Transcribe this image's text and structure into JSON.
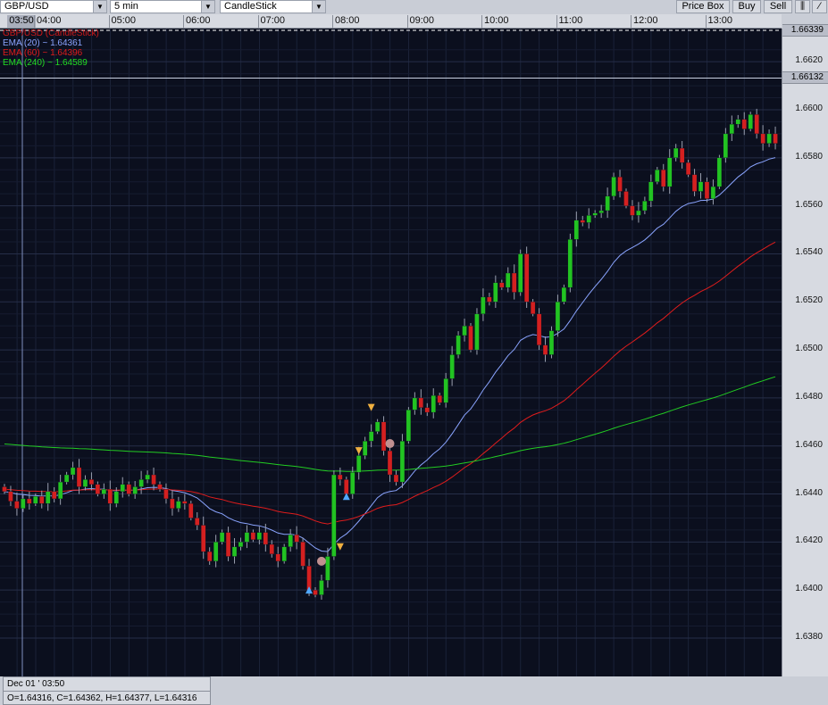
{
  "toolbar": {
    "symbol": "GBP/USD",
    "interval": "5 min",
    "chart_type": "CandleStick",
    "price_box": "Price Box",
    "buy": "Buy",
    "sell": "Sell",
    "bars_icon": "bars-icon",
    "line_icon": "line-icon"
  },
  "time_axis": {
    "current": "03:50",
    "labels": [
      "04:00",
      "05:00",
      "06:00",
      "07:00",
      "08:00",
      "09:00",
      "10:00",
      "11:00",
      "12:00",
      "13:00"
    ]
  },
  "price_axis": {
    "labels": [
      "1.6620",
      "1.6600",
      "1.6580",
      "1.6560",
      "1.6540",
      "1.6520",
      "1.6500",
      "1.6480",
      "1.6460",
      "1.6440",
      "1.6420",
      "1.6400",
      "1.6380"
    ],
    "top_marker": "1.66339",
    "line_marker": "1.66132"
  },
  "legend": [
    {
      "text": "GBP/USD (CandleStick)",
      "color": "#d01818"
    },
    {
      "text": "EMA (20) ~ 1.64361",
      "color": "#8aa4ff"
    },
    {
      "text": "EMA (60) ~ 1.64396",
      "color": "#e01c1c"
    },
    {
      "text": "EMA (240) ~ 1.64589",
      "color": "#22dd22"
    }
  ],
  "info": {
    "date": "Dec 01 ' 03:50",
    "ohlc": "O=1.64316, C=1.64362, H=1.64377, L=1.64316"
  },
  "chart_data": {
    "type": "candlestick",
    "start_time": "03:35",
    "interval_min": 5,
    "closes": [
      1.6441,
      1.6437,
      1.6434,
      1.6438,
      1.6436,
      1.6439,
      1.6436,
      1.6441,
      1.6438,
      1.6445,
      1.6448,
      1.6451,
      1.6443,
      1.6446,
      1.6444,
      1.644,
      1.6442,
      1.6436,
      1.6441,
      1.6444,
      1.644,
      1.6443,
      1.6446,
      1.6448,
      1.6444,
      1.6442,
      1.6438,
      1.6434,
      1.6437,
      1.6436,
      1.643,
      1.6427,
      1.6416,
      1.6412,
      1.642,
      1.6424,
      1.6414,
      1.6418,
      1.642,
      1.6424,
      1.6421,
      1.6424,
      1.6419,
      1.6415,
      1.6412,
      1.6418,
      1.6423,
      1.642,
      1.641,
      1.64,
      1.6398,
      1.6404,
      1.6414,
      1.6448,
      1.6446,
      1.644,
      1.6449,
      1.6456,
      1.6462,
      1.6466,
      1.647,
      1.6458,
      1.6448,
      1.6445,
      1.6462,
      1.6475,
      1.648,
      1.6476,
      1.6474,
      1.6481,
      1.6478,
      1.6488,
      1.6498,
      1.6506,
      1.651,
      1.65,
      1.6515,
      1.6522,
      1.652,
      1.6528,
      1.6526,
      1.6532,
      1.6524,
      1.654,
      1.652,
      1.6515,
      1.6502,
      1.6498,
      1.6508,
      1.652,
      1.6526,
      1.6546,
      1.6554,
      1.6553,
      1.6556,
      1.6557,
      1.6558,
      1.6564,
      1.6572,
      1.6566,
      1.656,
      1.6556,
      1.6558,
      1.6562,
      1.657,
      1.6575,
      1.6568,
      1.658,
      1.6584,
      1.6578,
      1.6573,
      1.6566,
      1.657,
      1.6563,
      1.6568,
      1.658,
      1.659,
      1.6594,
      1.6596,
      1.6592,
      1.6598,
      1.659,
      1.6586,
      1.659,
      1.6586
    ],
    "ema": [
      {
        "period": 20,
        "seed": 1.6441,
        "color": "#8aa4ff"
      },
      {
        "period": 60,
        "seed": 1.6442,
        "color": "#e01c1c"
      },
      {
        "period": 240,
        "seed": 1.6461,
        "color": "#22cc22"
      }
    ],
    "markers": [
      {
        "i": 54,
        "price": 1.6418,
        "type": "sell",
        "color": "#f0b040"
      },
      {
        "i": 49,
        "price": 1.64,
        "type": "buy",
        "color": "#50a8ff"
      },
      {
        "i": 51,
        "price": 1.6412,
        "type": "close",
        "color": "#c09090"
      },
      {
        "i": 55,
        "price": 1.6439,
        "type": "buy",
        "color": "#50a8ff"
      },
      {
        "i": 57,
        "price": 1.6458,
        "type": "sell",
        "color": "#f0b040"
      },
      {
        "i": 59,
        "price": 1.6476,
        "type": "sell",
        "color": "#f0b040"
      },
      {
        "i": 62,
        "price": 1.6461,
        "type": "close",
        "color": "#c09090"
      }
    ],
    "hline": 1.66132,
    "top_line": 1.66339,
    "y_range": [
      1.6367,
      1.6634
    ]
  }
}
